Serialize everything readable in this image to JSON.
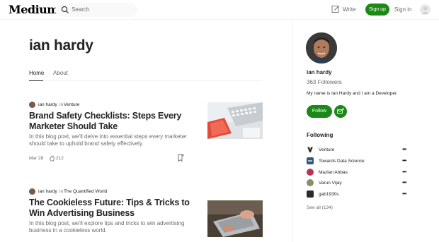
{
  "brand": {
    "logo_text": "Medium"
  },
  "nav": {
    "search_placeholder": "Search",
    "write_label": "Write",
    "signup_label": "Sign up",
    "signin_label": "Sign in"
  },
  "profile": {
    "name": "ian hardy",
    "tabs": [
      {
        "label": "Home",
        "active": true
      },
      {
        "label": "About",
        "active": false
      }
    ]
  },
  "posts": [
    {
      "author": "ian hardy",
      "in": "in",
      "publication": "Venture",
      "title": "Brand Safety Checklists: Steps Every Marketer Should Take",
      "excerpt": "In this blog post, we'll delve into essential steps every marketer should take to uphold brand safety effectively.",
      "date": "Mar 28",
      "claps": "212"
    },
    {
      "author": "ian hardy",
      "in": "in",
      "publication": "The Quantified World",
      "title": "The Cookieless Future: Tips & Tricks to Win Advertising Business",
      "excerpt": "In this blog post, we'll explore tips and tricks to win advertising business in a cookieless world."
    }
  ],
  "sidebar": {
    "name": "ian hardy",
    "followers": "363 Followers",
    "bio": "My name is Ian Hardy and I am a Developer.",
    "follow_label": "Follow",
    "following_heading": "Following",
    "following": [
      {
        "name": "Venture",
        "icon": "venture-logo"
      },
      {
        "name": "Towards Data Science",
        "icon": "tds-logo"
      },
      {
        "name": "Mazlan Abbas",
        "icon": "avatar"
      },
      {
        "name": "Varun Vijay",
        "icon": "avatar"
      },
      {
        "name": "gab1930s",
        "icon": "avatar"
      }
    ],
    "more_label": "•••",
    "see_all": "See all (134)"
  },
  "colors": {
    "accent": "#1a8917",
    "text": "#242424",
    "muted": "#6b6b6b"
  }
}
